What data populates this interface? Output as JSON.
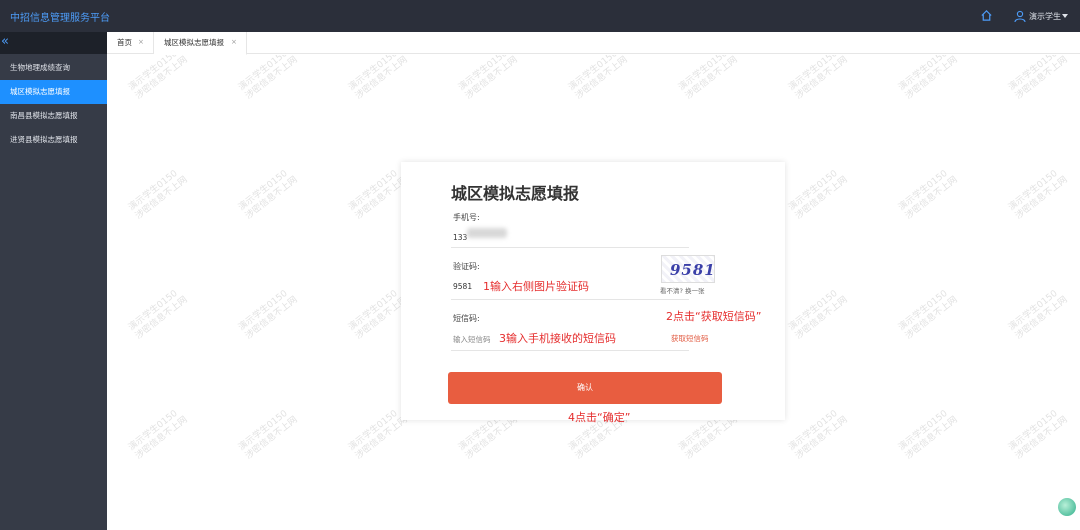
{
  "app": {
    "title": "中招信息管理服务平台",
    "user": "演示学生"
  },
  "icons": {
    "home": "home-icon",
    "user": "user-icon",
    "collapse": "double-chevron-left-icon",
    "float": "assistant-icon"
  },
  "colors": {
    "accent": "#1e90ff",
    "topbar": "#2b2f3a",
    "sidebar": "#363b47",
    "button": "#e85d40",
    "note": "#e52d2d"
  },
  "sidebar": {
    "collapse_glyph": "«",
    "items": [
      {
        "label": "生物地理成绩查询"
      },
      {
        "label": "城区模拟志愿填报"
      },
      {
        "label": "南昌县模拟志愿填报"
      },
      {
        "label": "进贤县模拟志愿填报"
      }
    ]
  },
  "tabs": [
    {
      "label": "首页",
      "close": "×"
    },
    {
      "label": "城区模拟志愿填报",
      "close": "×"
    }
  ],
  "watermark": {
    "line1": "演示学生0150",
    "line2": "涉密信息不上网"
  },
  "form": {
    "title": "城区模拟志愿填报",
    "phone_label": "手机号:",
    "phone_value": "133",
    "captcha_label": "验证码:",
    "captcha_value": "9581",
    "captcha_image_text": "9581",
    "captcha_refresh": "看不清? 换一张",
    "sms_label": "短信码:",
    "sms_placeholder": "输入短信码",
    "sms_button": "获取短信码",
    "confirm_button": "确认"
  },
  "notes": {
    "step1": "1输入右侧图片验证码",
    "step2": "2点击“获取短信码”",
    "step3": "3输入手机接收的短信码",
    "step4": "4点击“确定”"
  }
}
